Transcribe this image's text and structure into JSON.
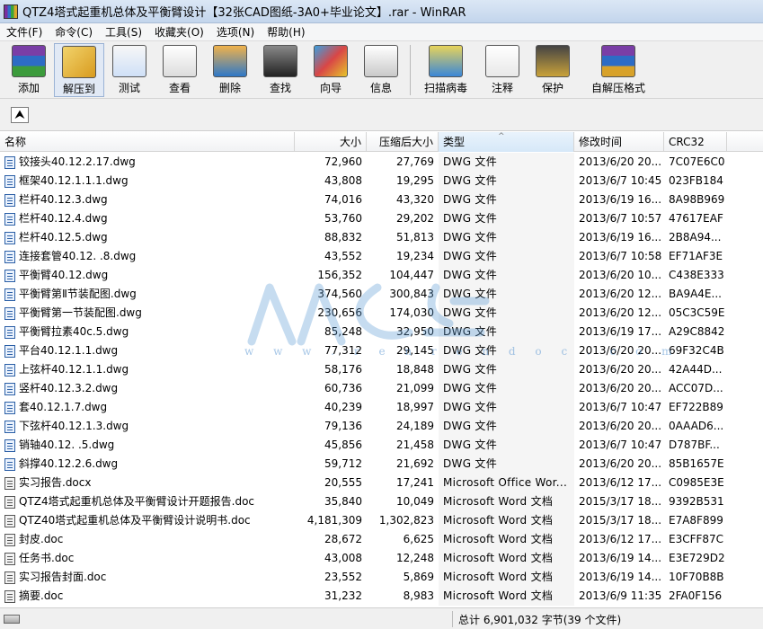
{
  "window": {
    "title": "QTZ4塔式起重机总体及平衡臂设计【32张CAD图纸-3A0+毕业论文】.rar - WinRAR"
  },
  "menu": [
    "文件(F)",
    "命令(C)",
    "工具(S)",
    "收藏夹(O)",
    "选项(N)",
    "帮助(H)"
  ],
  "toolbar": {
    "group1": [
      {
        "label": "添加",
        "icon": "archive-add-icon"
      },
      {
        "label": "解压到",
        "icon": "extract-to-icon"
      },
      {
        "label": "测试",
        "icon": "test-icon"
      },
      {
        "label": "查看",
        "icon": "view-icon"
      },
      {
        "label": "删除",
        "icon": "delete-icon"
      },
      {
        "label": "查找",
        "icon": "find-binoculars-icon"
      },
      {
        "label": "向导",
        "icon": "wizard-icon"
      },
      {
        "label": "信息",
        "icon": "info-icon"
      }
    ],
    "group2": [
      {
        "label": "扫描病毒",
        "icon": "virus-scan-icon"
      },
      {
        "label": "注释",
        "icon": "comment-icon"
      },
      {
        "label": "保护",
        "icon": "protect-shield-icon"
      },
      {
        "label": "自解压格式",
        "icon": "sfx-icon"
      }
    ]
  },
  "address": {
    "up_icon": "up-folder-icon"
  },
  "columns": {
    "name": "名称",
    "size": "大小",
    "packed": "压缩后大小",
    "type": "类型",
    "modified": "修改时间",
    "crc": "CRC32"
  },
  "files": [
    {
      "name": "铰接头40.12.2.17.dwg",
      "size": "72,960",
      "packed": "27,769",
      "type": "DWG 文件",
      "modified": "2013/6/20 20...",
      "crc": "7C07E6C0",
      "icon": "dwg"
    },
    {
      "name": "框架40.12.1.1.1.dwg",
      "size": "43,808",
      "packed": "19,295",
      "type": "DWG 文件",
      "modified": "2013/6/7 10:45",
      "crc": "023FB184",
      "icon": "dwg"
    },
    {
      "name": "栏杆40.12.3.dwg",
      "size": "74,016",
      "packed": "43,320",
      "type": "DWG 文件",
      "modified": "2013/6/19 16...",
      "crc": "8A98B969",
      "icon": "dwg"
    },
    {
      "name": "栏杆40.12.4.dwg",
      "size": "53,760",
      "packed": "29,202",
      "type": "DWG 文件",
      "modified": "2013/6/7 10:57",
      "crc": "47617EAF",
      "icon": "dwg"
    },
    {
      "name": "栏杆40.12.5.dwg",
      "size": "88,832",
      "packed": "51,813",
      "type": "DWG 文件",
      "modified": "2013/6/19 16...",
      "crc": "2B8A94...",
      "icon": "dwg"
    },
    {
      "name": "连接套管40.12. .8.dwg",
      "size": "43,552",
      "packed": "19,234",
      "type": "DWG 文件",
      "modified": "2013/6/7 10:58",
      "crc": "EF71AF3E",
      "icon": "dwg"
    },
    {
      "name": "平衡臂40.12.dwg",
      "size": "156,352",
      "packed": "104,447",
      "type": "DWG 文件",
      "modified": "2013/6/20 10...",
      "crc": "C438E333",
      "icon": "dwg"
    },
    {
      "name": "平衡臂第Ⅱ节装配图.dwg",
      "size": "374,560",
      "packed": "300,843",
      "type": "DWG 文件",
      "modified": "2013/6/20 12...",
      "crc": "BA9A4E...",
      "icon": "dwg"
    },
    {
      "name": "平衡臂第一节装配图.dwg",
      "size": "230,656",
      "packed": "174,030",
      "type": "DWG 文件",
      "modified": "2013/6/20 12...",
      "crc": "05C3C59E",
      "icon": "dwg"
    },
    {
      "name": "平衡臂拉素40c.5.dwg",
      "size": "85,248",
      "packed": "32,950",
      "type": "DWG 文件",
      "modified": "2013/6/19 17...",
      "crc": "A29C8842",
      "icon": "dwg"
    },
    {
      "name": "平台40.12.1.1.dwg",
      "size": "77,312",
      "packed": "29,145",
      "type": "DWG 文件",
      "modified": "2013/6/20 20...",
      "crc": "69F32C4B",
      "icon": "dwg"
    },
    {
      "name": "上弦杆40.12.1.1.dwg",
      "size": "58,176",
      "packed": "18,848",
      "type": "DWG 文件",
      "modified": "2013/6/20 20...",
      "crc": "42A44D...",
      "icon": "dwg"
    },
    {
      "name": "竖杆40.12.3.2.dwg",
      "size": "60,736",
      "packed": "21,099",
      "type": "DWG 文件",
      "modified": "2013/6/20 20...",
      "crc": "ACC07D...",
      "icon": "dwg"
    },
    {
      "name": "套40.12.1.7.dwg",
      "size": "40,239",
      "packed": "18,997",
      "type": "DWG 文件",
      "modified": "2013/6/7 10:47",
      "crc": "EF722B89",
      "icon": "dwg"
    },
    {
      "name": "下弦杆40.12.1.3.dwg",
      "size": "79,136",
      "packed": "24,189",
      "type": "DWG 文件",
      "modified": "2013/6/20 20...",
      "crc": "0AAAD6...",
      "icon": "dwg"
    },
    {
      "name": "销轴40.12. .5.dwg",
      "size": "45,856",
      "packed": "21,458",
      "type": "DWG 文件",
      "modified": "2013/6/7 10:47",
      "crc": "D787BF...",
      "icon": "dwg"
    },
    {
      "name": "斜撑40.12.2.6.dwg",
      "size": "59,712",
      "packed": "21,692",
      "type": "DWG 文件",
      "modified": "2013/6/20 20...",
      "crc": "85B1657E",
      "icon": "dwg"
    },
    {
      "name": "实习报告.docx",
      "size": "20,555",
      "packed": "17,241",
      "type": "Microsoft Office Wor...",
      "modified": "2013/6/12 17...",
      "crc": "C0985E3E",
      "icon": "doc"
    },
    {
      "name": "QTZ4塔式起重机总体及平衡臂设计开题报告.doc",
      "size": "35,840",
      "packed": "10,049",
      "type": "Microsoft Word 文档",
      "modified": "2015/3/17 18...",
      "crc": "9392B531",
      "icon": "doc"
    },
    {
      "name": "QTZ40塔式起重机总体及平衡臂设计说明书.doc",
      "size": "4,181,309",
      "packed": "1,302,823",
      "type": "Microsoft Word 文档",
      "modified": "2015/3/17 18...",
      "crc": "E7A8F899",
      "icon": "doc"
    },
    {
      "name": "封皮.doc",
      "size": "28,672",
      "packed": "6,625",
      "type": "Microsoft Word 文档",
      "modified": "2013/6/12 17...",
      "crc": "E3CFF87C",
      "icon": "doc"
    },
    {
      "name": "任务书.doc",
      "size": "43,008",
      "packed": "12,248",
      "type": "Microsoft Word 文档",
      "modified": "2013/6/19 14...",
      "crc": "E3E729D2",
      "icon": "doc"
    },
    {
      "name": "实习报告封面.doc",
      "size": "23,552",
      "packed": "5,869",
      "type": "Microsoft Word 文档",
      "modified": "2013/6/19 14...",
      "crc": "10F70B8B",
      "icon": "doc"
    },
    {
      "name": "摘要.doc",
      "size": "31,232",
      "packed": "8,983",
      "type": "Microsoft Word 文档",
      "modified": "2013/6/9 11:35",
      "crc": "2FA0F156",
      "icon": "doc"
    }
  ],
  "watermark": {
    "text": "w w w . r e n r e n d o c . c o m",
    "color": "#5b9bd5"
  },
  "status": {
    "summary": "总计 6,901,032 字节(39 个文件)"
  }
}
